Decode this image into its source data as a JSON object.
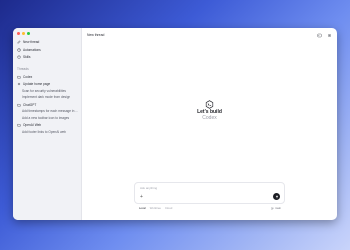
{
  "window": {
    "title": "New thread"
  },
  "sidebar": {
    "nav": [
      {
        "label": "New thread",
        "icon": "edit-icon"
      },
      {
        "label": "Automations",
        "icon": "clock-icon"
      },
      {
        "label": "Skills",
        "icon": "puzzle-icon"
      }
    ],
    "threads_label": "Threads",
    "groups": [
      {
        "name": "Codex",
        "items": []
      },
      {
        "name": "Update home page",
        "items": [
          "Scan for security vulnerabilities",
          "Implement dark mode from design"
        ]
      },
      {
        "name": "ChatGPT",
        "items": [
          "Add timestamps for each message in c…",
          "Add a new toolbar icon to images"
        ]
      },
      {
        "name": "OpenAI Web",
        "items": [
          "Add footer links to OpenAI web"
        ]
      }
    ]
  },
  "center": {
    "headline": "Let's build",
    "subline": "Codex"
  },
  "composer": {
    "placeholder": "Ask anything",
    "modes": [
      "Local",
      "Worktree",
      "Cloud"
    ],
    "active_mode": "Local",
    "branch": "main"
  }
}
